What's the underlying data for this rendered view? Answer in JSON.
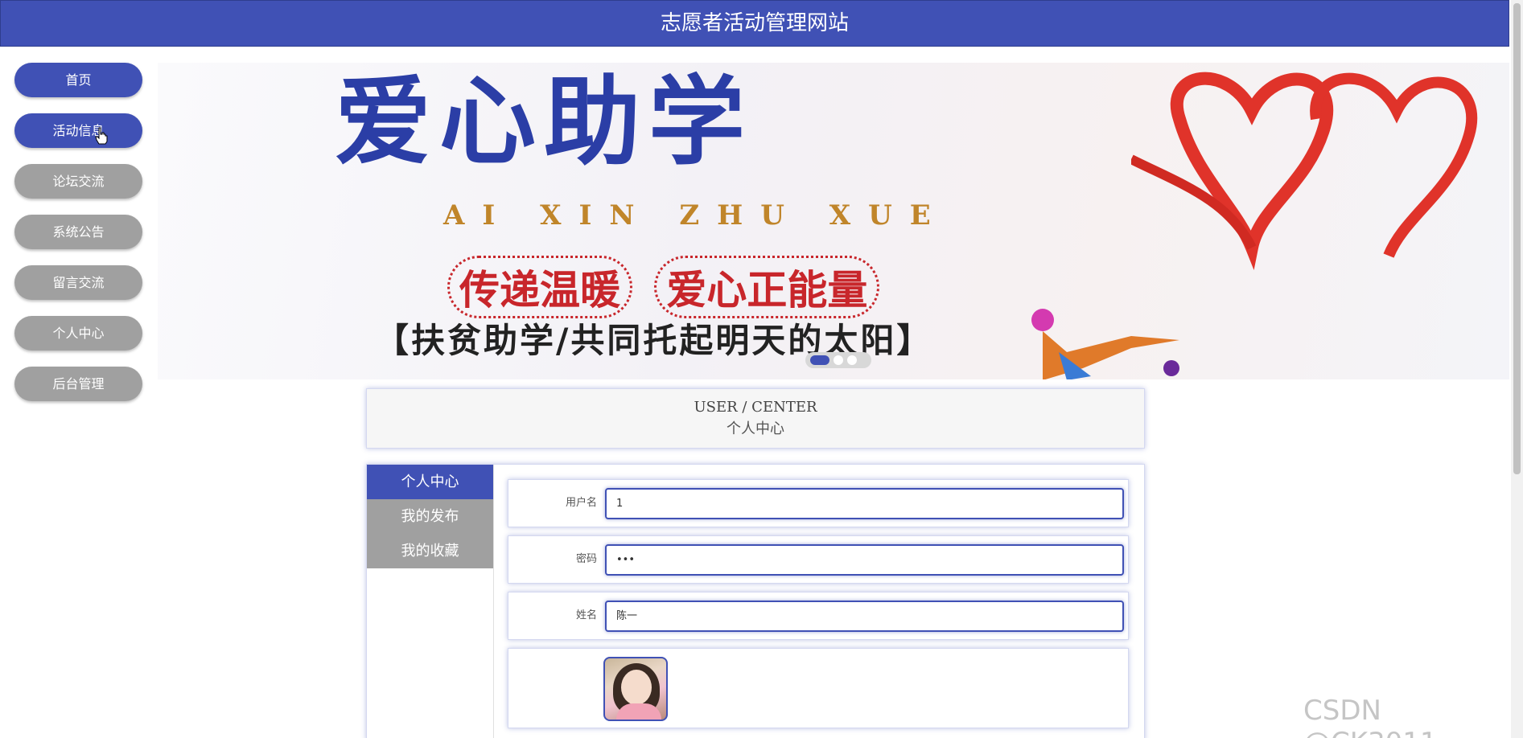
{
  "header": {
    "title": "志愿者活动管理网站"
  },
  "sidebar": {
    "items": [
      {
        "label": "首页"
      },
      {
        "label": "活动信息"
      },
      {
        "label": "论坛交流"
      },
      {
        "label": "系统公告"
      },
      {
        "label": "留言交流"
      },
      {
        "label": "个人中心"
      },
      {
        "label": "后台管理"
      }
    ]
  },
  "banner": {
    "line1": "爱心助学",
    "line2": "AI XIN ZHU XUE",
    "line3a": "传递温暖",
    "line3b": "爱心正能量",
    "line4": "【扶贫助学/共同托起明天的太阳】"
  },
  "user_center": {
    "title_en": "USER / CENTER",
    "title_cn": "个人中心",
    "tabs": [
      {
        "label": "个人中心"
      },
      {
        "label": "我的发布"
      },
      {
        "label": "我的收藏"
      }
    ],
    "form": {
      "username_label": "用户名",
      "username_value": "1",
      "password_label": "密码",
      "password_value": "•••",
      "name_label": "姓名",
      "name_value": "陈一"
    }
  },
  "watermark": "CSDN @CK3011",
  "colors": {
    "primary": "#4051b5",
    "inactive": "#a0a0a0"
  }
}
